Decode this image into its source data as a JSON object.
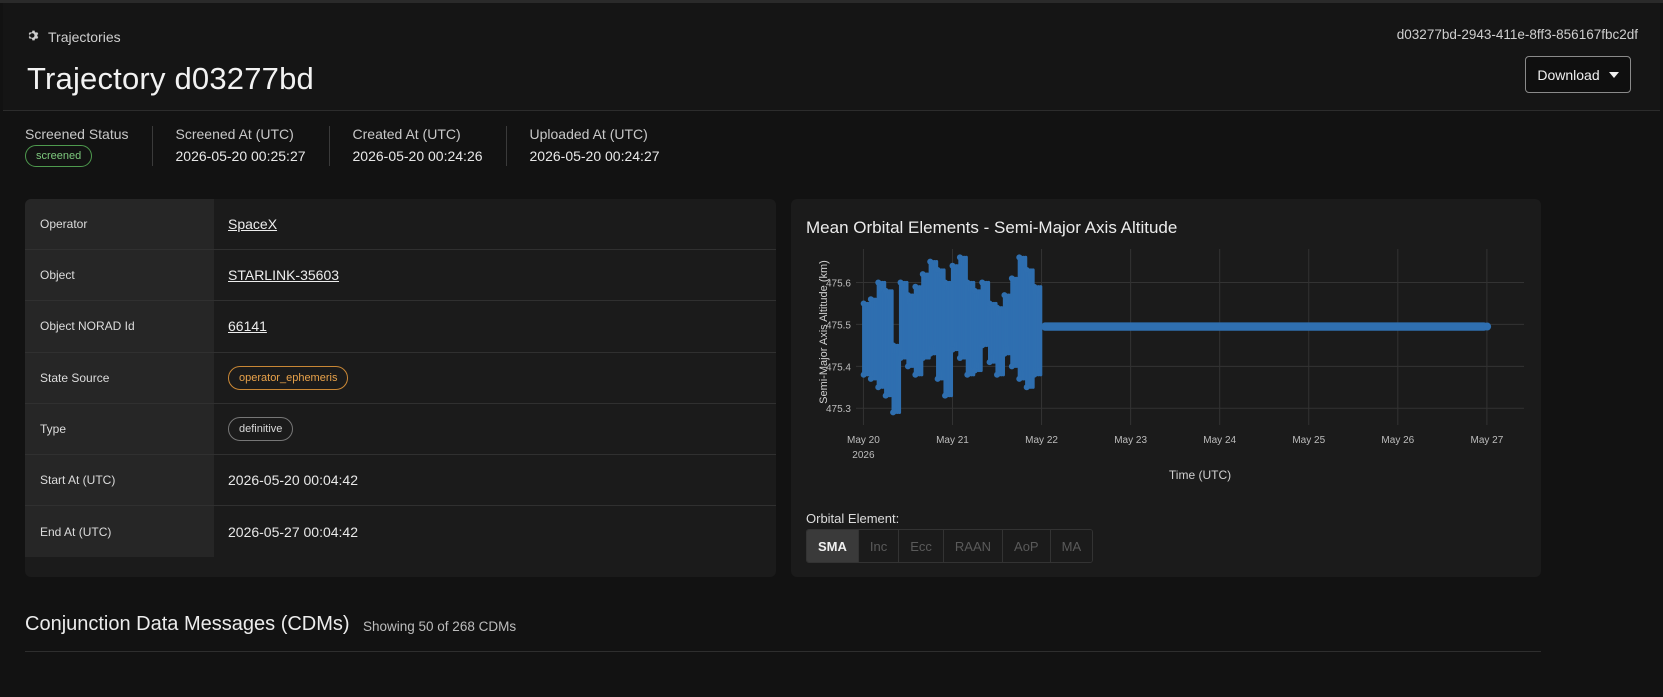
{
  "header": {
    "breadcrumb_label": "Trajectories",
    "title": "Trajectory d03277bd",
    "trajectory_id": "d03277bd-2943-411e-8ff3-856167fbc2df",
    "download_label": "Download"
  },
  "status": {
    "screened_status_label": "Screened Status",
    "screened_status_value": "screened",
    "screened_at_label": "Screened At (UTC)",
    "screened_at_value": "2026-05-20 00:25:27",
    "created_at_label": "Created At (UTC)",
    "created_at_value": "2026-05-20 00:24:26",
    "uploaded_at_label": "Uploaded At (UTC)",
    "uploaded_at_value": "2026-05-20 00:24:27"
  },
  "info": {
    "operator_label": "Operator",
    "operator_value": "SpaceX",
    "object_label": "Object",
    "object_value": "STARLINK-35603",
    "norad_label": "Object NORAD Id",
    "norad_value": "66141",
    "state_source_label": "State Source",
    "state_source_value": "operator_ephemeris",
    "type_label": "Type",
    "type_value": "definitive",
    "start_label": "Start At (UTC)",
    "start_value": "2026-05-20 00:04:42",
    "end_label": "End At (UTC)",
    "end_value": "2026-05-27 00:04:42"
  },
  "chart_data": {
    "type": "scatter",
    "title": "Mean Orbital Elements - Semi-Major Axis Altitude",
    "xlabel": "Time (UTC)",
    "ylabel": "Semi-Major Axis Altitude (km)",
    "x_tick_labels": [
      "May 20",
      "May 21",
      "May 22",
      "May 23",
      "May 24",
      "May 25",
      "May 26",
      "May 27"
    ],
    "x_tick_sublabel": "2026",
    "y_ticks": [
      475.3,
      475.4,
      475.5,
      475.6
    ],
    "xlim": [
      "2026-05-19 22:00",
      "2026-05-27 10:00"
    ],
    "ylim": [
      475.26,
      475.68
    ],
    "color": "#2f6fb0",
    "grid": true,
    "series": [
      {
        "x": [
          "2026-05-20 00:04",
          "2026-05-20 02:00",
          "2026-05-20 04:00",
          "2026-05-20 06:00",
          "2026-05-20 08:00",
          "2026-05-20 10:00",
          "2026-05-20 12:00",
          "2026-05-20 14:00",
          "2026-05-20 16:00",
          "2026-05-20 18:00",
          "2026-05-20 20:00",
          "2026-05-20 22:00",
          "2026-05-21 00:00",
          "2026-05-21 02:00",
          "2026-05-21 04:00",
          "2026-05-21 06:00",
          "2026-05-21 08:00",
          "2026-05-21 10:00",
          "2026-05-21 12:00",
          "2026-05-21 14:00",
          "2026-05-21 16:00",
          "2026-05-21 18:00",
          "2026-05-21 20:00",
          "2026-05-21 22:00",
          "2026-05-22 00:04",
          "2026-05-23 00:00",
          "2026-05-24 00:00",
          "2026-05-25 00:00",
          "2026-05-26 00:00",
          "2026-05-27 00:04"
        ],
        "y_min": [
          475.38,
          475.37,
          475.35,
          475.33,
          475.29,
          475.42,
          475.4,
          475.38,
          475.42,
          475.43,
          475.37,
          475.33,
          475.44,
          475.42,
          475.38,
          475.39,
          475.45,
          475.41,
          475.38,
          475.43,
          475.4,
          475.37,
          475.35,
          475.38,
          475.48,
          475.485,
          475.485,
          475.485,
          475.485,
          475.485
        ],
        "y_max": [
          475.55,
          475.56,
          475.6,
          475.58,
          475.45,
          475.6,
          475.57,
          475.59,
          475.62,
          475.65,
          475.63,
          475.6,
          475.64,
          475.66,
          475.6,
          475.58,
          475.6,
          475.55,
          475.54,
          475.57,
          475.61,
          475.66,
          475.63,
          475.59,
          475.56,
          475.505,
          475.505,
          475.505,
          475.505,
          475.505
        ]
      }
    ]
  },
  "orbital_element": {
    "label": "Orbital Element:",
    "options": [
      "SMA",
      "Inc",
      "Ecc",
      "RAAN",
      "AoP",
      "MA"
    ],
    "selected": "SMA"
  },
  "cdm": {
    "title": "Conjunction Data Messages (CDMs)",
    "count_text": "Showing 50 of 268 CDMs"
  }
}
